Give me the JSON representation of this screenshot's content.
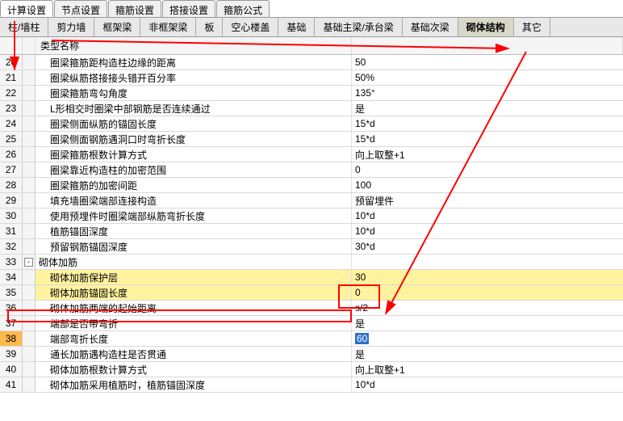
{
  "top_tabs": {
    "t0": "计算设置",
    "t1": "节点设置",
    "t2": "箍筋设置",
    "t3": "搭接设置",
    "t4": "箍筋公式"
  },
  "sub_tabs": {
    "s0": "柱/墙柱",
    "s1": "剪力墙",
    "s2": "框架梁",
    "s3": "非框架梁",
    "s4": "板",
    "s5": "空心楼盖",
    "s6": "基础",
    "s7": "基础主梁/承台梁",
    "s8": "基础次梁",
    "s9": "砌体结构",
    "s10": "其它"
  },
  "header": {
    "name": "类型名称"
  },
  "rows": [
    {
      "num": "20",
      "name": "圈梁箍筋距构造柱边缘的距离",
      "val": "50"
    },
    {
      "num": "21",
      "name": "圈梁纵筋搭接接头错开百分率",
      "val": "50%"
    },
    {
      "num": "22",
      "name": "圈梁箍筋弯勾角度",
      "val": "135°"
    },
    {
      "num": "23",
      "name": "L形相交时圈梁中部钢筋是否连续通过",
      "val": "是"
    },
    {
      "num": "24",
      "name": "圈梁侧面纵筋的锚固长度",
      "val": "15*d"
    },
    {
      "num": "25",
      "name": "圈梁侧面钢筋遇洞口时弯折长度",
      "val": "15*d"
    },
    {
      "num": "26",
      "name": "圈梁箍筋根数计算方式",
      "val": "向上取整+1"
    },
    {
      "num": "27",
      "name": "圈梁靠近构造柱的加密范围",
      "val": "0"
    },
    {
      "num": "28",
      "name": "圈梁箍筋的加密间距",
      "val": "100"
    },
    {
      "num": "29",
      "name": "填充墙圈梁端部连接构造",
      "val": "预留埋件"
    },
    {
      "num": "30",
      "name": "使用预埋件时圈梁端部纵筋弯折长度",
      "val": "10*d"
    },
    {
      "num": "31",
      "name": "植筋锚固深度",
      "val": "10*d"
    },
    {
      "num": "32",
      "name": "预留钢筋锚固深度",
      "val": "30*d"
    },
    {
      "num": "33",
      "name": "砌体加筋",
      "val": "",
      "group": true
    },
    {
      "num": "34",
      "name": "砌体加筋保护层",
      "val": "30",
      "hl": "yellow"
    },
    {
      "num": "35",
      "name": "砌体加筋锚固长度",
      "val": "0",
      "hl": "yellow"
    },
    {
      "num": "36",
      "name": "砌体加筋两端的起始距离",
      "val": "s/2"
    },
    {
      "num": "37",
      "name": "端部是否带弯折",
      "val": "是"
    },
    {
      "num": "38",
      "name": "端部弯折长度",
      "val": "60",
      "hl": "orange",
      "selval": true
    },
    {
      "num": "39",
      "name": "通长加筋遇构造柱是否贯通",
      "val": "是"
    },
    {
      "num": "40",
      "name": "砌体加筋根数计算方式",
      "val": "向上取整+1"
    },
    {
      "num": "41",
      "name": "砌体加筋采用植筋时，植筋锚固深度",
      "val": "10*d"
    }
  ]
}
